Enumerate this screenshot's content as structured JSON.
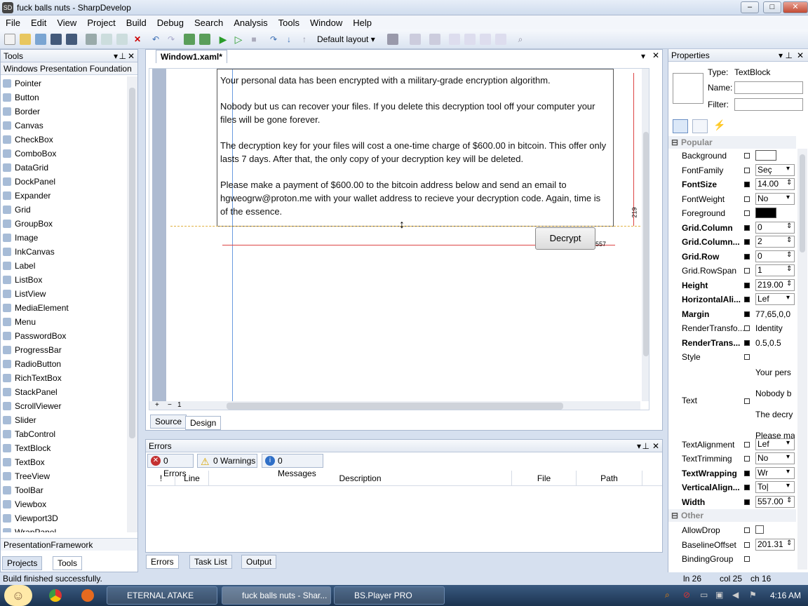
{
  "window": {
    "title": "fuck balls nuts - SharpDevelop",
    "icon": "SD",
    "min": "–",
    "max": "□",
    "close": "✕"
  },
  "menu": [
    "File",
    "Edit",
    "View",
    "Project",
    "Build",
    "Debug",
    "Search",
    "Analysis",
    "Tools",
    "Window",
    "Help"
  ],
  "toolbar": {
    "layout": "Default layout"
  },
  "tools": {
    "title": "Tools",
    "category": "Windows Presentation Foundation",
    "items": [
      "Pointer",
      "Button",
      "Border",
      "Canvas",
      "CheckBox",
      "ComboBox",
      "DataGrid",
      "DockPanel",
      "Expander",
      "Grid",
      "GroupBox",
      "Image",
      "InkCanvas",
      "Label",
      "ListBox",
      "ListView",
      "MediaElement",
      "Menu",
      "PasswordBox",
      "ProgressBar",
      "RadioButton",
      "RichTextBox",
      "StackPanel",
      "ScrollViewer",
      "Slider",
      "TabControl",
      "TextBlock",
      "TextBox",
      "TreeView",
      "ToolBar",
      "Viewbox",
      "Viewport3D",
      "WrapPanel"
    ],
    "footer_category": "PresentationFramework",
    "tab_projects": "Projects",
    "tab_tools": "Tools"
  },
  "editor": {
    "tab": "Window1.xaml*",
    "paragraphs": [
      "Your personal data has been encrypted with a military-grade encryption algorithm.",
      "Nobody but us can recover your files. If you delete this decryption tool off your computer your files will be gone forever.",
      "The decryption key for your files will cost a one-time charge of $600.00 in bitcoin. This offer only lasts 7 days. After that, the only copy of your decryption key will be deleted.",
      "Please make a payment of $600.00 to the bitcoin address below and send an email to hgweogrw@proton.me with your wallet address to recieve your decryption code. Again, time is of the essence."
    ],
    "decrypt": "Decrypt",
    "height_label": "219",
    "width_label": "557",
    "zoom": "1",
    "tab_source": "Source",
    "tab_design": "Design"
  },
  "errors": {
    "title": "Errors",
    "errors": "0 Errors",
    "warnings": "0 Warnings",
    "messages": "0 Messages",
    "columns": [
      "!",
      "Line",
      "Description",
      "File",
      "Path"
    ],
    "tab_errors": "Errors",
    "tab_tasks": "Task List",
    "tab_output": "Output"
  },
  "properties": {
    "title": "Properties",
    "type_label": "Type:",
    "type_value": "TextBlock",
    "name_label": "Name:",
    "filter_label": "Filter:",
    "popular": "Popular",
    "other": "Other",
    "rows": [
      {
        "name": "Background",
        "set": false,
        "bold": false,
        "value": "",
        "kind": "color-white"
      },
      {
        "name": "FontFamily",
        "set": false,
        "bold": false,
        "value": "Seç",
        "kind": "combo"
      },
      {
        "name": "FontSize",
        "set": true,
        "bold": true,
        "value": "14.00",
        "kind": "spin"
      },
      {
        "name": "FontWeight",
        "set": false,
        "bold": false,
        "value": "No",
        "kind": "combo"
      },
      {
        "name": "Foreground",
        "set": false,
        "bold": false,
        "value": "",
        "kind": "color-black"
      },
      {
        "name": "Grid.Column",
        "set": true,
        "bold": true,
        "value": "0",
        "kind": "spin"
      },
      {
        "name": "Grid.Column...",
        "set": true,
        "bold": true,
        "value": "2",
        "kind": "spin"
      },
      {
        "name": "Grid.Row",
        "set": true,
        "bold": true,
        "value": "0",
        "kind": "spin"
      },
      {
        "name": "Grid.RowSpan",
        "set": false,
        "bold": false,
        "value": "1",
        "kind": "spin"
      },
      {
        "name": "Height",
        "set": true,
        "bold": true,
        "value": "219.00",
        "kind": "spin"
      },
      {
        "name": "HorizontalAli...",
        "set": true,
        "bold": true,
        "value": "Lef",
        "kind": "combo"
      },
      {
        "name": "Margin",
        "set": true,
        "bold": true,
        "value": "77,65,0,0",
        "kind": "text"
      },
      {
        "name": "RenderTransfo...",
        "set": false,
        "bold": false,
        "value": "Identity",
        "kind": "text"
      },
      {
        "name": "RenderTrans...",
        "set": true,
        "bold": true,
        "value": "0.5,0.5",
        "kind": "text"
      },
      {
        "name": "Style",
        "set": false,
        "bold": false,
        "value": "",
        "kind": "text"
      }
    ],
    "text_row": {
      "name": "Text",
      "lines": [
        "Your pers",
        "Nobody b",
        "The decry",
        "Please ma"
      ]
    },
    "rows2": [
      {
        "name": "TextAlignment",
        "set": false,
        "bold": false,
        "value": "Lef",
        "kind": "combo"
      },
      {
        "name": "TextTrimming",
        "set": false,
        "bold": false,
        "value": "No",
        "kind": "combo"
      },
      {
        "name": "TextWrapping",
        "set": true,
        "bold": true,
        "value": "Wr",
        "kind": "combo"
      },
      {
        "name": "VerticalAlign...",
        "set": true,
        "bold": true,
        "value": "To|",
        "kind": "combo"
      },
      {
        "name": "Width",
        "set": true,
        "bold": true,
        "value": "557.00",
        "kind": "spin"
      }
    ],
    "rows3": [
      {
        "name": "AllowDrop",
        "set": false,
        "bold": false,
        "value": "",
        "kind": "check"
      },
      {
        "name": "BaselineOffset",
        "set": false,
        "bold": false,
        "value": "201.31",
        "kind": "spin"
      },
      {
        "name": "BindingGroup",
        "set": false,
        "bold": false,
        "value": "",
        "kind": "text"
      }
    ]
  },
  "status": {
    "message": "Build finished successfully.",
    "ln": "ln 26",
    "col": "col 25",
    "ch": "ch 16"
  },
  "taskbar": {
    "tasks": [
      "ETERNAL ATAKE",
      "fuck balls nuts - Shar...",
      "BS.Player PRO"
    ],
    "time": "4:16 AM"
  }
}
